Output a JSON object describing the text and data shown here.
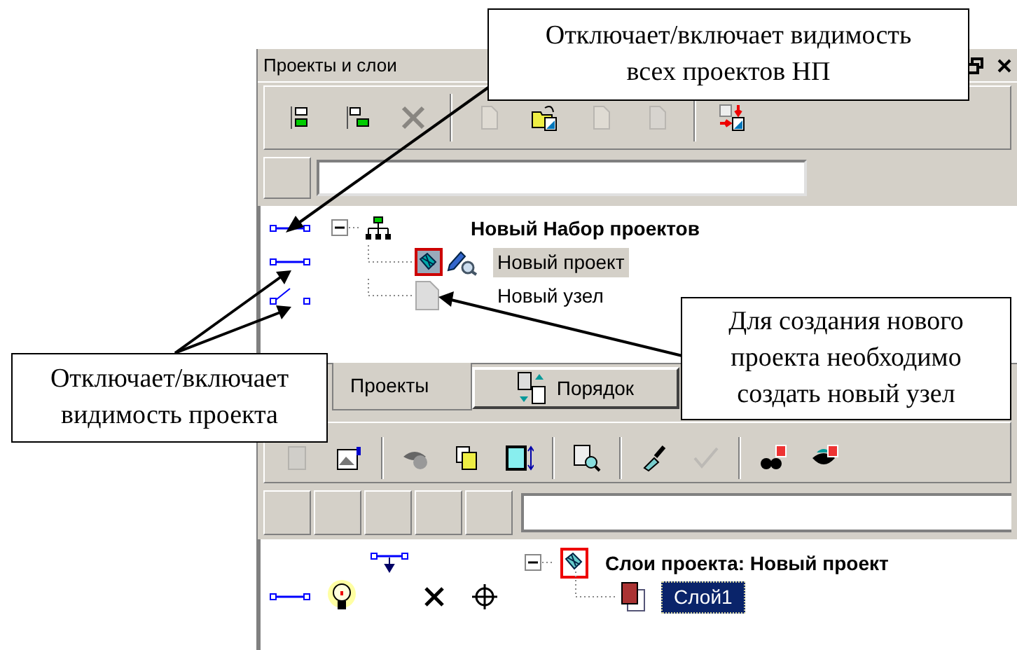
{
  "window": {
    "title": "Проекты и слои"
  },
  "toolbar": [
    {
      "disabled": false
    },
    {
      "disabled": false
    },
    {
      "disabled": true
    },
    {
      "disabled": true
    },
    {
      "disabled": false
    },
    {
      "disabled": true
    },
    {
      "disabled": true
    },
    {
      "disabled": false
    }
  ],
  "project_tree": [
    {
      "label": "Новый Набор проектов",
      "kind": "set",
      "visible": true,
      "expanded": true,
      "children": [
        {
          "label": "Новый проект",
          "kind": "project",
          "visible": true,
          "selected": true
        },
        {
          "label": "Новый узел",
          "kind": "node",
          "visible": false,
          "selected": false
        }
      ]
    }
  ],
  "tabs": [
    {
      "label": "Проекты",
      "selected": true
    },
    {
      "label": "Порядок",
      "selected": false
    }
  ],
  "layer_toolbar": [
    {
      "disabled": true
    },
    {
      "disabled": false
    },
    {
      "disabled": false
    },
    {
      "disabled": false
    },
    {
      "disabled": false
    },
    {
      "disabled": false
    },
    {
      "disabled": false
    },
    {
      "disabled": true
    },
    {
      "disabled": false
    },
    {
      "disabled": false
    }
  ],
  "layer_tree": [
    {
      "label": "Слои проекта: Новый проект",
      "expanded": true,
      "children": [
        {
          "label": "Слой1",
          "visible": true,
          "selected": true
        }
      ]
    }
  ],
  "callouts": [
    {
      "lines": [
        "Отключает/включает видимость",
        "всех проектов НП"
      ]
    },
    {
      "lines": [
        "Отключает/включает",
        "видимость проекта"
      ]
    },
    {
      "lines": [
        "Для создания нового",
        "проекта необходимо",
        "создать новый узел"
      ]
    }
  ]
}
